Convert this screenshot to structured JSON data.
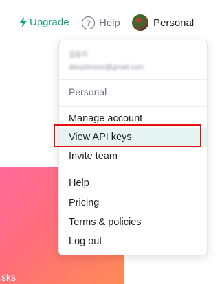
{
  "header": {
    "upgrade_label": "Upgrade",
    "help_label": "Help",
    "help_icon": "?",
    "account_label": "Personal"
  },
  "menu": {
    "user": {
      "name": "길동이",
      "email": "alexjohnson@gmail.com"
    },
    "org_label": "Personal",
    "group1": [
      "Manage account",
      "View API keys",
      "Invite team"
    ],
    "group2": [
      "Help",
      "Pricing",
      "Terms & policies",
      "Log out"
    ]
  },
  "hero": {
    "text": "sks"
  },
  "colors": {
    "accent": "#10a37f",
    "highlight": "#e01111",
    "hover_bg": "#e6f4f1"
  }
}
